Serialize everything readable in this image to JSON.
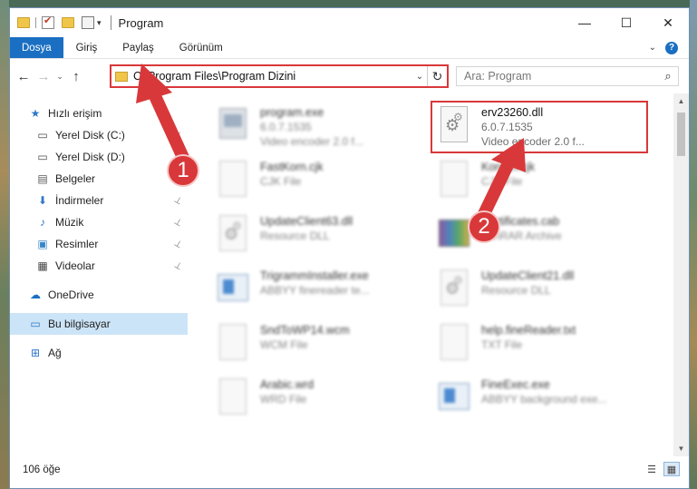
{
  "window": {
    "title": "Program",
    "controls": {
      "minimize": "—",
      "maximize": "☐",
      "close": "✕"
    }
  },
  "ribbon": {
    "tabs": [
      "Dosya",
      "Giriş",
      "Paylaş",
      "Görünüm"
    ],
    "expand": "⌄",
    "help": "?"
  },
  "address": {
    "path": "C:\\Program Files\\Program Dizini",
    "refresh": "↻",
    "dropdown": "⌄"
  },
  "search": {
    "placeholder": "Ara: Program",
    "icon": "⌕"
  },
  "nav": {
    "back": "←",
    "forward": "→",
    "recent": "⌄",
    "up": "↑"
  },
  "sidebar": {
    "items": [
      {
        "label": "Hızlı erişim",
        "icon": "star-icon",
        "glyph": "★",
        "color": "#2f77c9",
        "pinned": false
      },
      {
        "label": "Yerel Disk (C:)",
        "icon": "drive-icon",
        "glyph": "▭",
        "color": "#4a4a4a",
        "pinned": true
      },
      {
        "label": "Yerel Disk (D:)",
        "icon": "drive-icon",
        "glyph": "▭",
        "color": "#4a4a4a",
        "pinned": true
      },
      {
        "label": "Belgeler",
        "icon": "documents-icon",
        "glyph": "▤",
        "color": "#5a5a5a",
        "pinned": true
      },
      {
        "label": "İndirmeler",
        "icon": "download-icon",
        "glyph": "⬇",
        "color": "#2f77c9",
        "pinned": true
      },
      {
        "label": "Müzik",
        "icon": "music-icon",
        "glyph": "♪",
        "color": "#2f77c9",
        "pinned": true
      },
      {
        "label": "Resimler",
        "icon": "pictures-icon",
        "glyph": "▣",
        "color": "#3a86c8",
        "pinned": true
      },
      {
        "label": "Videolar",
        "icon": "video-icon",
        "glyph": "▦",
        "color": "#444",
        "pinned": true
      },
      {
        "label": "OneDrive",
        "icon": "cloud-icon",
        "glyph": "☁",
        "color": "#1a6fc2",
        "pinned": false
      },
      {
        "label": "Bu bilgisayar",
        "icon": "computer-icon",
        "glyph": "▭",
        "color": "#2f77c9",
        "pinned": false
      },
      {
        "label": "Ağ",
        "icon": "network-icon",
        "glyph": "⊞",
        "color": "#2f77c9",
        "pinned": false
      }
    ],
    "pin_glyph": "📌"
  },
  "files": [
    {
      "name": "program.exe",
      "line1": "6.0.7.1535",
      "line2": "Video encoder 2.0 f...",
      "type": "exe",
      "blurred": true
    },
    {
      "name": "erv23260.dll",
      "line1": "6.0.7.1535",
      "line2": "Video encoder 2.0 f...",
      "type": "dll",
      "blurred": false
    },
    {
      "name": "FastKorn.cjk",
      "line1": "CJK File",
      "line2": "",
      "type": "doc",
      "blurred": true
    },
    {
      "name": "Korean.cjk",
      "line1": "CJK File",
      "line2": "",
      "type": "doc",
      "blurred": true
    },
    {
      "name": "UpdateClient63.dll",
      "line1": "Resource DLL",
      "line2": "",
      "type": "dll",
      "blurred": true
    },
    {
      "name": "Certificates.cab",
      "line1": "WinRAR Archive",
      "line2": "",
      "type": "cab",
      "blurred": true
    },
    {
      "name": "TrigrammInstaller.exe",
      "line1": "ABBYY finereader te...",
      "line2": "",
      "type": "app",
      "blurred": true
    },
    {
      "name": "UpdateClient21.dll",
      "line1": "Resource DLL",
      "line2": "",
      "type": "dll",
      "blurred": true
    },
    {
      "name": "SndToWP14.wcm",
      "line1": "WCM File",
      "line2": "",
      "type": "doc",
      "blurred": true
    },
    {
      "name": "help.fineReader.txt",
      "line1": "TXT File",
      "line2": "",
      "type": "doc",
      "blurred": true
    },
    {
      "name": "Arabic.wrd",
      "line1": "WRD File",
      "line2": "",
      "type": "doc",
      "blurred": true
    },
    {
      "name": "FineExec.exe",
      "line1": "ABBYY background exe...",
      "line2": "",
      "type": "app",
      "blurred": true
    }
  ],
  "status": {
    "count": "106 öğe"
  },
  "annotations": {
    "badge1": "1",
    "badge2": "2",
    "color": "#d9383a"
  }
}
